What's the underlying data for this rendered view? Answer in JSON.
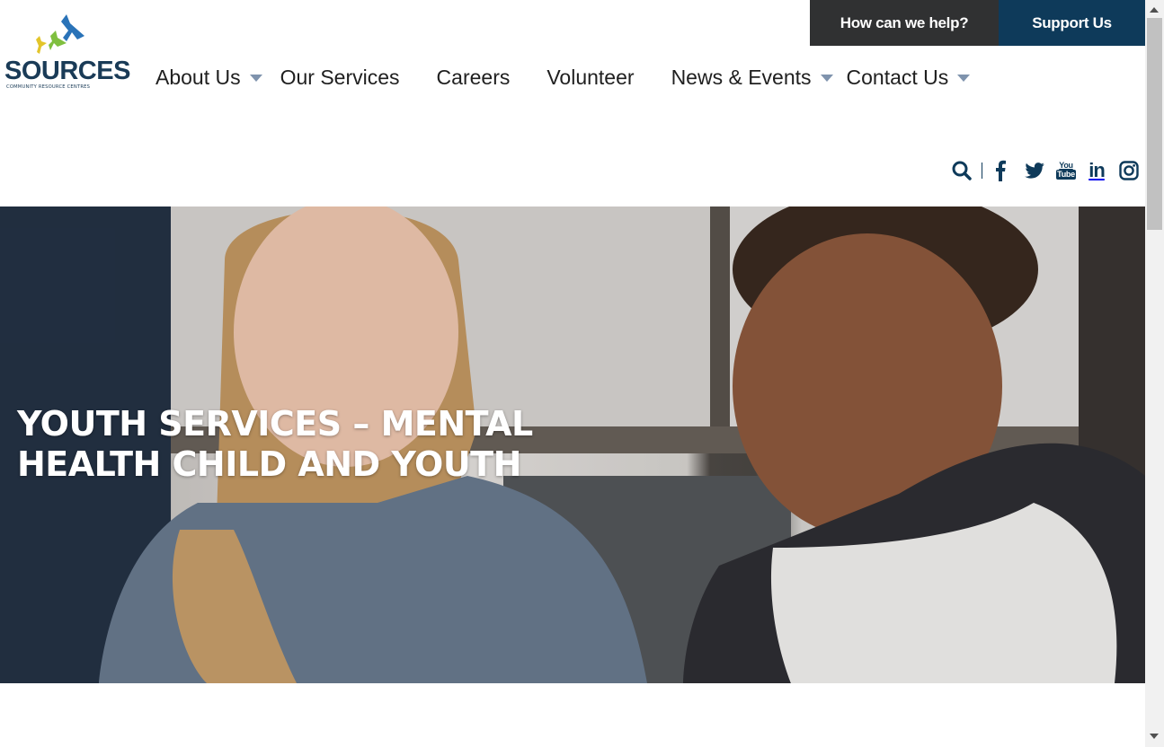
{
  "logo": {
    "wordmark": "SOURCES",
    "tagline": "COMMUNITY RESOURCE CENTRES",
    "colors": {
      "blue_bird": "#2a73b8",
      "green_bird": "#7fbf3f",
      "yellow_bird": "#e3c52a",
      "text": "#1a3b57"
    }
  },
  "topbar": {
    "help_label": "How can we help?",
    "support_label": "Support Us"
  },
  "nav": {
    "items": [
      {
        "label": "About Us",
        "has_dropdown": true
      },
      {
        "label": "Our Services",
        "has_dropdown": false
      },
      {
        "label": "Careers",
        "has_dropdown": false
      },
      {
        "label": "Volunteer",
        "has_dropdown": false
      },
      {
        "label": "News & Events",
        "has_dropdown": true
      },
      {
        "label": "Contact Us",
        "has_dropdown": true
      }
    ]
  },
  "social": {
    "icons": [
      "search-icon",
      "facebook-icon",
      "twitter-icon",
      "youtube-icon",
      "linkedin-icon",
      "instagram-icon"
    ],
    "youtube_top": "You",
    "youtube_bottom": "Tube",
    "linkedin_text": "in"
  },
  "hero": {
    "title": "YOUTH SERVICES – MENTAL HEALTH CHILD AND YOUTH"
  },
  "colors": {
    "brand_dark": "#0e3a5a",
    "topbar_dark": "#303132",
    "nav_text": "#1f1f1f",
    "caret": "#7f93ad"
  }
}
